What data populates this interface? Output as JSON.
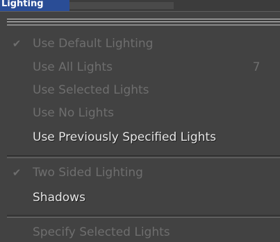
{
  "menubar": {
    "title": "Lighting"
  },
  "menu": {
    "items": [
      {
        "label": "Use Default Lighting",
        "checked": true,
        "enabled": false,
        "hotkey": ""
      },
      {
        "label": "Use All Lights",
        "checked": false,
        "enabled": false,
        "hotkey": "7"
      },
      {
        "label": "Use Selected Lights",
        "checked": false,
        "enabled": false,
        "hotkey": ""
      },
      {
        "label": "Use No Lights",
        "checked": false,
        "enabled": false,
        "hotkey": ""
      },
      {
        "label": "Use Previously Specified Lights",
        "checked": false,
        "enabled": true,
        "hotkey": ""
      },
      {
        "label": "Two Sided Lighting",
        "checked": true,
        "enabled": false,
        "hotkey": ""
      },
      {
        "label": "Shadows",
        "checked": false,
        "enabled": true,
        "hotkey": ""
      },
      {
        "label": "Specify Selected Lights",
        "checked": false,
        "enabled": false,
        "hotkey": ""
      }
    ],
    "check_glyph": "✔"
  },
  "colors": {
    "background": "#424242",
    "enabled_text": "#e6e6e6",
    "disabled_text": "#6e6e6e",
    "menubar_highlight": "#2a4d96"
  }
}
